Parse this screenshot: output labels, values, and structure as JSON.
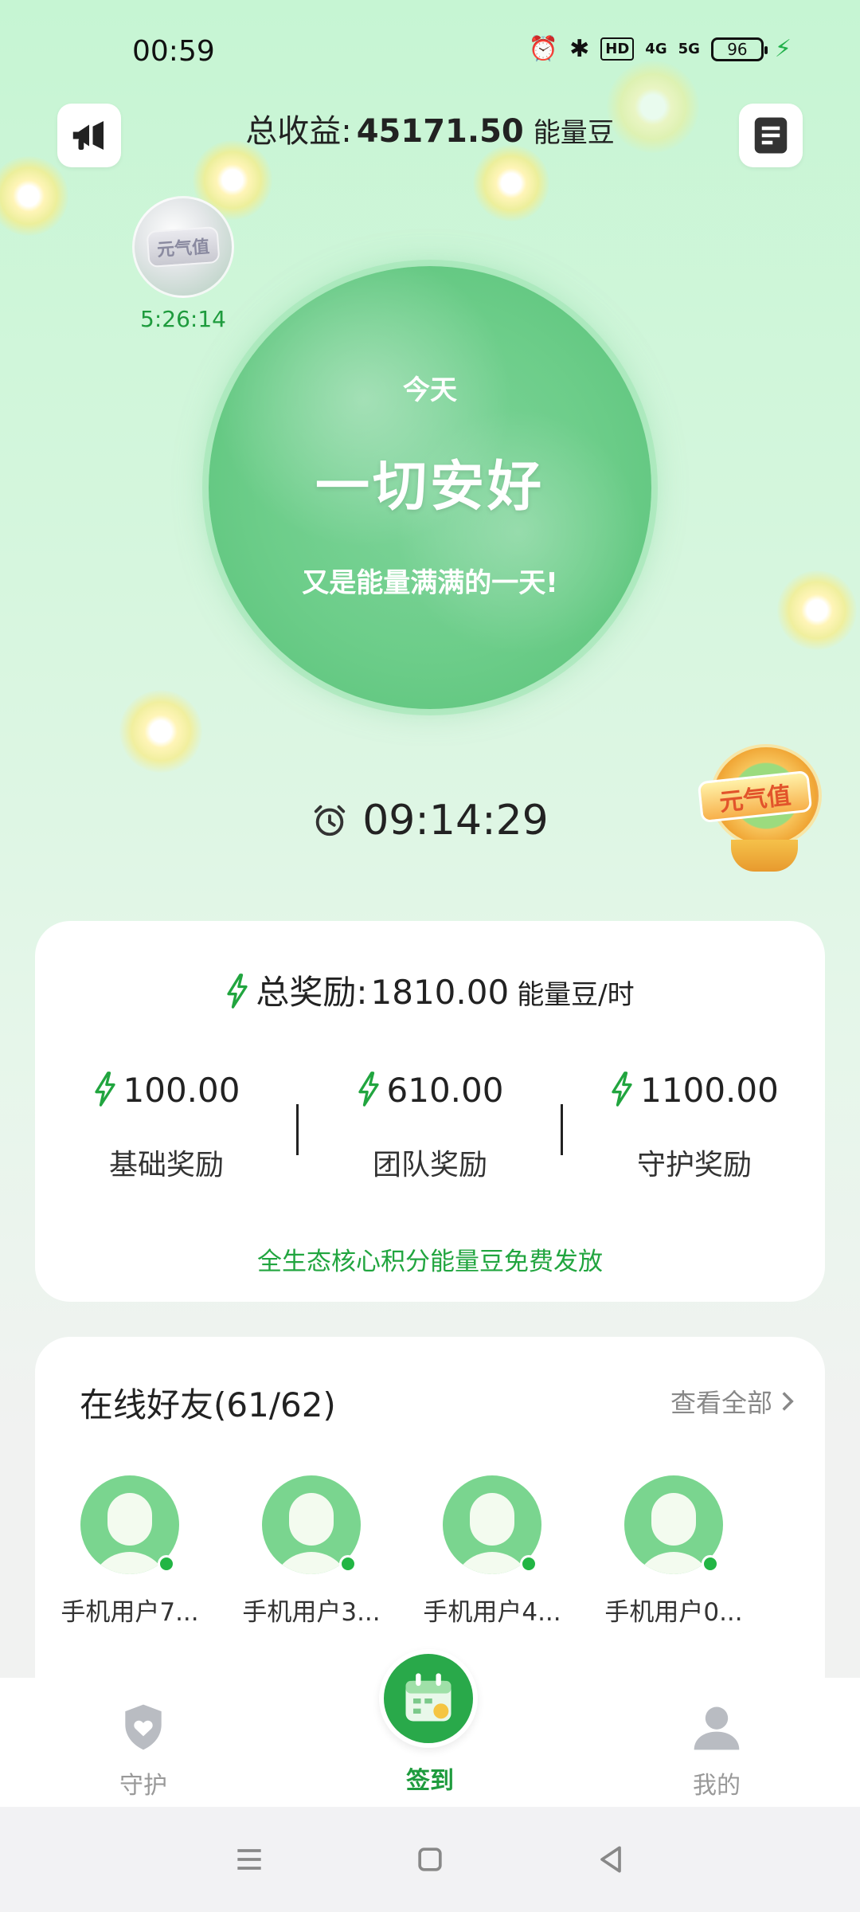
{
  "status_bar": {
    "time": "00:59",
    "hd_label": "HD",
    "net_4g": "4G",
    "net_5g": "5G",
    "battery": "96"
  },
  "header": {
    "total_earnings_label": "总收益:",
    "total_earnings_value": "45171.50",
    "total_earnings_unit": "能量豆"
  },
  "small_badge": {
    "label": "元气值",
    "timer": "5:26:14"
  },
  "main_circle": {
    "today": "今天",
    "headline": "一切安好",
    "subtitle": "又是能量满满的一天!"
  },
  "countdown": "09:14:29",
  "trophy_badge": {
    "label": "元气值"
  },
  "rewards": {
    "total_label": "总奖励:",
    "total_value": "1810.00",
    "total_unit": "能量豆/时",
    "items": [
      {
        "value": "100.00",
        "label": "基础奖励"
      },
      {
        "value": "610.00",
        "label": "团队奖励"
      },
      {
        "value": "1100.00",
        "label": "守护奖励"
      }
    ],
    "note": "全生态核心积分能量豆免费发放"
  },
  "friends": {
    "title": "在线好友(61/62)",
    "view_all": "查看全部",
    "list": [
      {
        "name": "手机用户7..."
      },
      {
        "name": "手机用户3..."
      },
      {
        "name": "手机用户4..."
      },
      {
        "name": "手机用户0..."
      }
    ]
  },
  "bottom_nav": {
    "guard": "守护",
    "checkin": "签到",
    "mine": "我的"
  },
  "colors": {
    "accent_green": "#21a53f",
    "glow_yellow": "#fff5b8",
    "online_dot": "#22b544"
  }
}
